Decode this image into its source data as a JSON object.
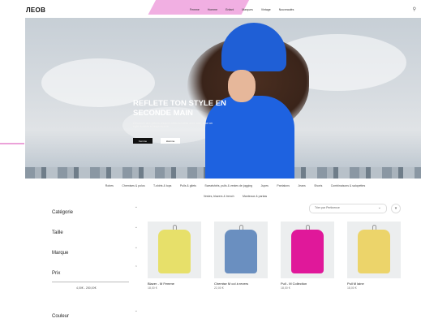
{
  "header": {
    "logo": "ЛЕОВ",
    "nav": [
      "Femme",
      "Homme",
      "Enfant",
      "Marques",
      "Vintage",
      "Nouveautés"
    ],
    "icons": [
      "search-icon",
      "account-icon",
      "bag-icon"
    ]
  },
  "hero": {
    "title_line1": "REFLETE TON STYLE EN",
    "title_line2": "SECONDE MAIN",
    "subtitle": "Découvre des pièces uniques sélectionnées avec soin, pour un style durable et responsable.",
    "button_primary": "Femme",
    "button_secondary": "Homme"
  },
  "categories": [
    "Robes",
    "Chemises & polos",
    "T-shirts & tops",
    "Pulls & gilets",
    "Sweatshirts, pulls & vestes de jogging",
    "Jupes",
    "Pantalons",
    "Jeans",
    "Shorts",
    "Combinaisons & salopettes",
    "Vestes, blazers & trench",
    "Manteaux & parkas"
  ],
  "filters": {
    "categorie": "Catégorie",
    "taille": "Taille",
    "marque": "Marque",
    "prix": "Prix",
    "price_range": "4,00€ - 250,00€",
    "couleur": "Couleur"
  },
  "toolbar": {
    "sort_label": "Trier par Pertinence"
  },
  "products": [
    {
      "name": "Blazer - M Femme",
      "price": "18,00 €",
      "color": "#e7e06a"
    },
    {
      "name": "Chemise M col à revers",
      "price": "22,00 €",
      "color": "#6a8fc0"
    },
    {
      "name": "Pull - M Collection",
      "price": "18,00 €",
      "color": "#e0189a"
    },
    {
      "name": "Pull M laine",
      "price": "18,00 €",
      "color": "#ecd46a"
    }
  ]
}
